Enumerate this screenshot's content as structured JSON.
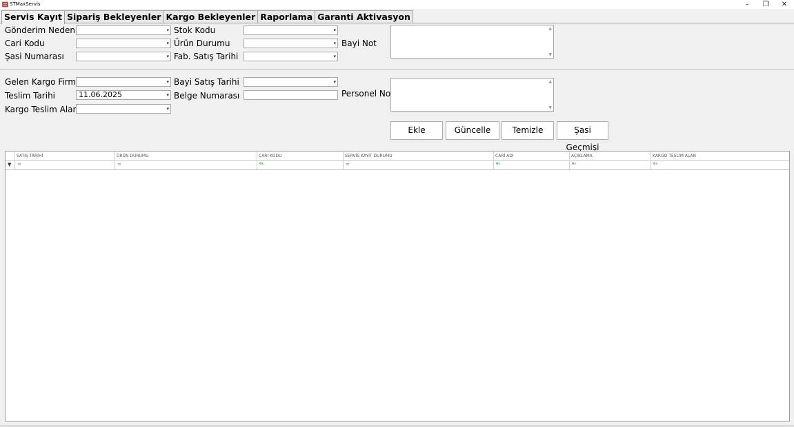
{
  "window": {
    "title": "STMaxServis",
    "minimize": "–",
    "restore": "❐",
    "close": "✕"
  },
  "tabs": [
    "Servis Kayıt",
    "Sipariş Bekleyenler",
    "Kargo Bekleyenler",
    "Raporlama",
    "Garanti Aktivasyon"
  ],
  "form": {
    "gonderim_nedeni": {
      "label": "Gönderim Nedeni",
      "value": ""
    },
    "stok_kodu": {
      "label": "Stok Kodu",
      "value": ""
    },
    "cari_kodu": {
      "label": "Cari Kodu",
      "value": ""
    },
    "urun_durumu": {
      "label": "Ürün Durumu",
      "value": ""
    },
    "bayi_not": {
      "label": "Bayi Not",
      "value": ""
    },
    "sasi_numarasi": {
      "label": "Şasi Numarası",
      "value": ""
    },
    "fab_satis_tarihi": {
      "label": "Fab. Satış Tarihi",
      "value": ""
    },
    "gelen_kargo_firmasi": {
      "label": "Gelen Kargo Firması",
      "value": ""
    },
    "bayi_satis_tarihi": {
      "label": "Bayi Satış Tarihi",
      "value": ""
    },
    "teslim_tarihi": {
      "label": "Teslim Tarihi",
      "value": "11.06.2025"
    },
    "belge_numarasi": {
      "label": "Belge Numarası",
      "value": ""
    },
    "personel_not": {
      "label": "Personel Not",
      "value": ""
    },
    "kargo_teslim_alan": {
      "label": "Kargo Teslim Alan",
      "value": ""
    }
  },
  "buttons": {
    "ekle": "Ekle",
    "guncelle": "Güncelle",
    "temizle": "Temizle",
    "sasi_gecmisi": "Şasi Geçmişi"
  },
  "grid": {
    "columns": [
      "SATIŞ TARİHİ",
      "ÜRÜN DURUMU",
      "CARİ KODU",
      "SERVİS KAYIT DURUMU",
      "CARİ ADI",
      "AÇIKLAMA",
      "KARGO TESLİM ALAN"
    ],
    "filter_icon": "▼",
    "filters": [
      "=",
      "=",
      "ᴮᶜ",
      "=",
      "ᴮᶜ",
      "ᴮᶜ",
      "ᴮᶜ"
    ]
  }
}
